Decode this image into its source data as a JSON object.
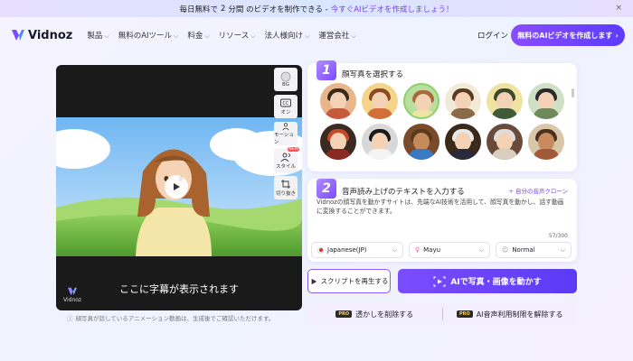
{
  "announcement": {
    "text_before": "毎日無料で",
    "number": "2",
    "text_mid": "分間 のビデオを制作できる -",
    "link": "今すぐAIビデオを作成しましょう！",
    "close": "×"
  },
  "nav": {
    "brand": "Vidnoz",
    "menu": [
      "製品",
      "無料のAIツール",
      "料金",
      "リソース",
      "法人様向け",
      "運営会社"
    ],
    "login": "ログイン",
    "cta": "無料のAIビデオを作成します",
    "cta_arrow": "›"
  },
  "video": {
    "subtitle": "ここに字幕が表示されます",
    "watermark": "Vidnoz",
    "tools": [
      {
        "label": "BG",
        "icon": "circle-icon"
      },
      {
        "label": "オン",
        "icon": "cc-icon"
      },
      {
        "label": "モーション",
        "icon": "motion-icon"
      },
      {
        "label": "スタイル",
        "icon": "style-icon",
        "badge": "NEW"
      },
      {
        "label": "切り抜き",
        "icon": "crop-icon"
      }
    ],
    "note": "顔写真が話しているアニメーション動画は、生成後でご確認いただけます。"
  },
  "step1": {
    "num": "1",
    "title": "顔写真を選択する"
  },
  "step2": {
    "num": "2",
    "title": "音声読み上げのテキストを入力する",
    "clone_link": "+ 自分の音声クローン",
    "text": "Vidnozの顔写真を動かすサイトは、先端なAI技術を活用して、顔写真を動かし、話す動画に変換することができます。",
    "counter": "57/300",
    "language": "Japanese(JP)",
    "voice": "Mayu",
    "style": "Normal"
  },
  "actions": {
    "play_script": "スクリプトを再生する",
    "animate": "AIで写真・画像を動かす",
    "remove_watermark": "透かしを削除する",
    "unlock_voice": "AI音声利用制限を解除する",
    "pro": "PRO"
  },
  "colors": {
    "accent": "#7a4dff",
    "accent_dark": "#5a3bf5",
    "panel_bg": "#ffffff"
  }
}
